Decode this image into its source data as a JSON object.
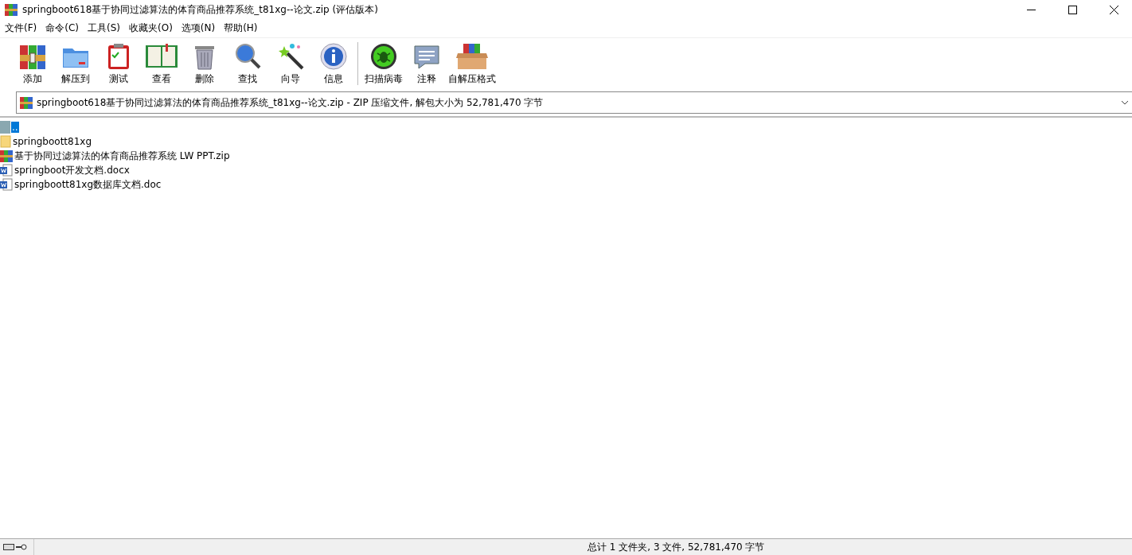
{
  "window": {
    "title": "springboot618基于协同过滤算法的体育商品推荐系统_t81xg--论文.zip (评估版本)"
  },
  "menu": [
    "文件(F)",
    "命令(C)",
    "工具(S)",
    "收藏夹(O)",
    "选项(N)",
    "帮助(H)"
  ],
  "toolbar_groups": [
    {
      "buttons": [
        "添加",
        "解压到",
        "测试",
        "查看",
        "删除",
        "查找",
        "向导",
        "信息"
      ]
    },
    {
      "buttons": [
        "扫描病毒",
        "注释",
        "自解压格式"
      ]
    }
  ],
  "address": {
    "value": "springboot618基于协同过滤算法的体育商品推荐系统_t81xg--论文.zip - ZIP 压缩文件, 解包大小为 52,781,470 字节"
  },
  "files": [
    {
      "kind": "up",
      "name": "..",
      "selected": true
    },
    {
      "kind": "folder",
      "name": "springboott81xg",
      "selected": false
    },
    {
      "kind": "archive",
      "name": "基于协同过滤算法的体育商品推荐系统 LW PPT.zip",
      "selected": false
    },
    {
      "kind": "word",
      "name": "springboot开发文档.docx",
      "selected": false
    },
    {
      "kind": "word",
      "name": "springboott81xg数据库文档.doc",
      "selected": false
    }
  ],
  "status_bar": {
    "text": "总计 1 文件夹, 3 文件, 52,781,470 字节"
  }
}
